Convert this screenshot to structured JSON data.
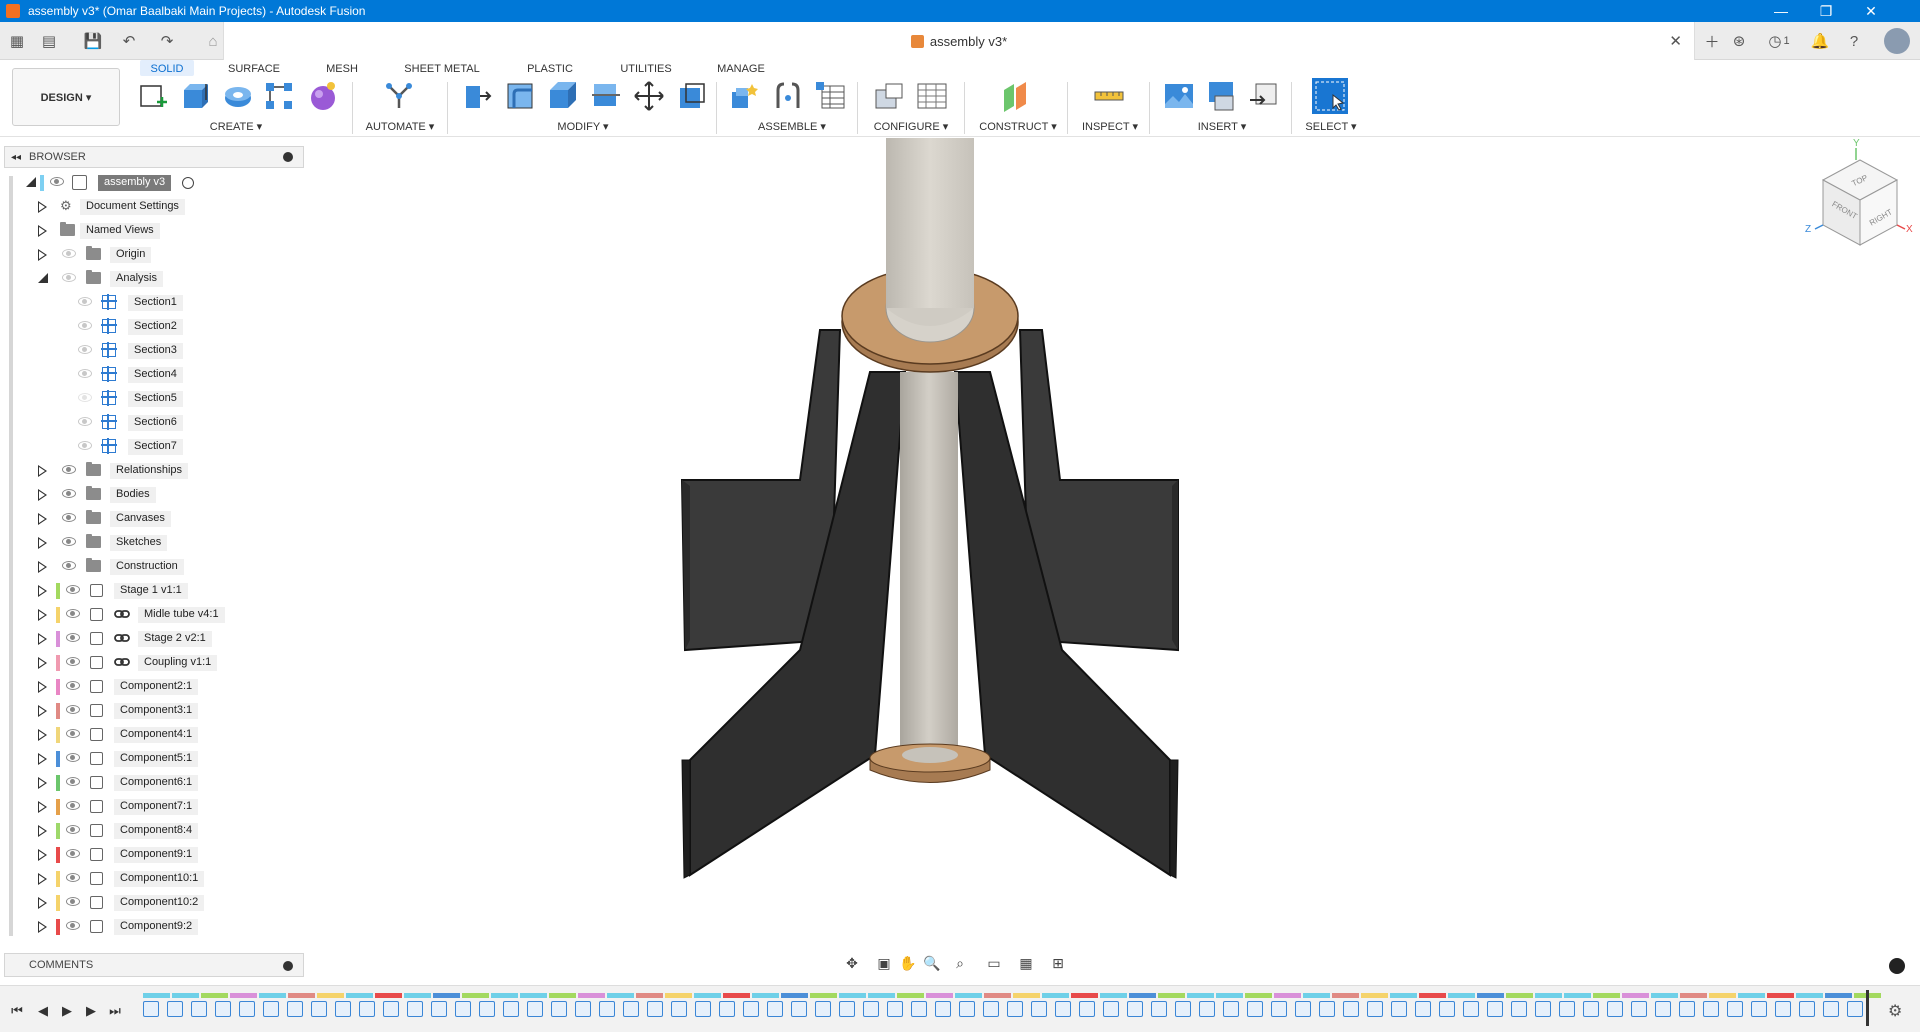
{
  "window": {
    "title": "assembly v3* (Omar Baalbaki Main Projects) - Autodesk Fusion",
    "minimize": "—",
    "maximize": "❐",
    "close": "✕"
  },
  "tab": {
    "document_title": "assembly v3*",
    "close": "✕",
    "notifications_count": "1"
  },
  "toolbar": {
    "design_button": "DESIGN ▾",
    "workspace_tabs": [
      "SOLID",
      "SURFACE",
      "MESH",
      "SHEET METAL",
      "PLASTIC",
      "UTILITIES",
      "MANAGE"
    ],
    "groups": {
      "create": "CREATE ▾",
      "automate": "AUTOMATE ▾",
      "modify": "MODIFY ▾",
      "assemble": "ASSEMBLE ▾",
      "configure": "CONFIGURE ▾",
      "construct": "CONSTRUCT ▾",
      "inspect": "INSPECT ▾",
      "insert": "INSERT ▾",
      "select": "SELECT ▾"
    }
  },
  "browser": {
    "header": "BROWSER",
    "root": "assembly v3",
    "items": [
      {
        "label": "Document Settings"
      },
      {
        "label": "Named Views"
      },
      {
        "label": "Origin"
      },
      {
        "label": "Analysis"
      },
      {
        "label": "Section1"
      },
      {
        "label": "Section2"
      },
      {
        "label": "Section3"
      },
      {
        "label": "Section4"
      },
      {
        "label": "Section5"
      },
      {
        "label": "Section6"
      },
      {
        "label": "Section7"
      },
      {
        "label": "Relationships"
      },
      {
        "label": "Bodies"
      },
      {
        "label": "Canvases"
      },
      {
        "label": "Sketches"
      },
      {
        "label": "Construction"
      },
      {
        "label": "Stage 1 v1:1",
        "color": "#a3d95f"
      },
      {
        "label": "Midle tube v4:1",
        "color": "#f5d36b"
      },
      {
        "label": "Stage 2 v2:1",
        "color": "#d990d9"
      },
      {
        "label": "Coupling v1:1",
        "color": "#f09ab0"
      },
      {
        "label": "Component2:1",
        "color": "#e986c4"
      },
      {
        "label": "Component3:1",
        "color": "#e08a84"
      },
      {
        "label": "Component4:1",
        "color": "#f0d67a"
      },
      {
        "label": "Component5:1",
        "color": "#4c8fd8"
      },
      {
        "label": "Component6:1",
        "color": "#6cc66c"
      },
      {
        "label": "Component7:1",
        "color": "#e5a04a"
      },
      {
        "label": "Component8:4",
        "color": "#9ed86a"
      },
      {
        "label": "Component9:1",
        "color": "#e84a4a"
      },
      {
        "label": "Component10:1",
        "color": "#f5d36b"
      },
      {
        "label": "Component10:2",
        "color": "#f5d36b"
      },
      {
        "label": "Component9:2",
        "color": "#e84a4a"
      }
    ]
  },
  "comments": {
    "header": "COMMENTS"
  },
  "viewcube": {
    "top": "TOP",
    "front": "FRONT",
    "right": "RIGHT",
    "axis_x": "X",
    "axis_y": "Y",
    "axis_z": "Z"
  },
  "timeline": {
    "controls": [
      "⏮",
      "◀",
      "▶",
      "▶",
      "⏭"
    ]
  }
}
